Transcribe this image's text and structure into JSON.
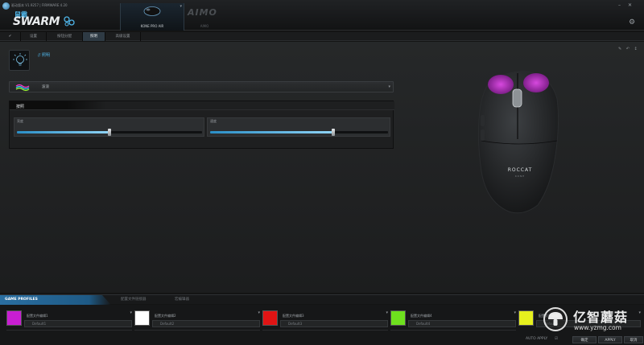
{
  "header": {
    "version": "驱动版本 V1.9257 | FIRMWARE 4.20",
    "brand_top": "鼠霸",
    "brand_main": "SWARM",
    "devices": [
      {
        "name": "KONE PRO AIR",
        "active": true
      },
      {
        "logo": "AIMO",
        "name": "AIMO",
        "active": false
      }
    ],
    "window_controls": {
      "minimize": "–",
      "close": "✕"
    }
  },
  "tabs": [
    {
      "label": "✔"
    },
    {
      "label": "设置"
    },
    {
      "label": "按钮分配"
    },
    {
      "label": "照明",
      "active": true
    },
    {
      "label": "高级设置"
    }
  ],
  "main": {
    "section_title": "// 照明",
    "corner_tools": "✎ ↶ ↕",
    "mode_select": {
      "value": "波浪",
      "icon": "wave-effect-icon"
    },
    "panel": {
      "title": "按照",
      "sliders": [
        {
          "label": "亮度",
          "value": 0.5
        },
        {
          "label": "速度",
          "value": 0.65
        }
      ]
    },
    "mouse": {
      "logo": "ROCCAT",
      "sub": "KONE"
    }
  },
  "profiles": {
    "tabs": [
      {
        "label": "GAME PROFILES",
        "active": true
      },
      {
        "label": "配置文件链接器"
      },
      {
        "label": "宏编辑器"
      }
    ],
    "slots": [
      {
        "name": "配置文件编辑1",
        "default": "Default1",
        "color": "#c81ed2"
      },
      {
        "name": "配置文件编辑2",
        "default": "Default2",
        "color": "#ffffff"
      },
      {
        "name": "配置文件编辑3",
        "default": "Default3",
        "color": "#e01414"
      },
      {
        "name": "配置文件编辑4",
        "default": "Default4",
        "color": "#6ee01e"
      },
      {
        "name": "配置文件编辑5",
        "default": "Default5",
        "color": "#e6f01e"
      }
    ],
    "auto_apply": "AUTO APPLY",
    "buttons": {
      "ok": "确定",
      "apply": "APPLY",
      "cancel": "取消"
    }
  },
  "watermark": {
    "cn": "亿智蘑菇",
    "url": "www.yzmg.com"
  }
}
